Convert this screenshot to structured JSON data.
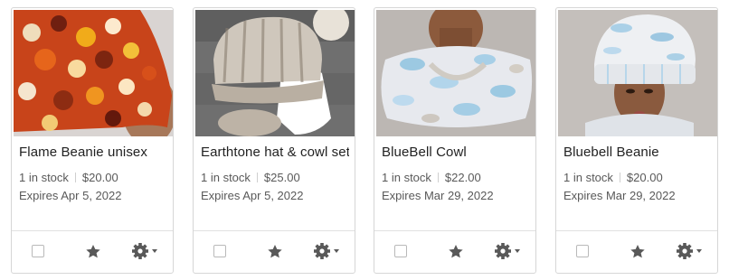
{
  "listings": [
    {
      "title": "Flame Beanie unisex",
      "stock": "1 in stock",
      "price": "$20.00",
      "expires": "Expires Apr 5, 2022",
      "image": "flame-beanie-photo"
    },
    {
      "title": "Earthtone hat & cowl set",
      "stock": "1 in stock",
      "price": "$25.00",
      "expires": "Expires Apr 5, 2022",
      "image": "earthtone-hat-photo"
    },
    {
      "title": "BlueBell Cowl",
      "stock": "1 in stock",
      "price": "$22.00",
      "expires": "Expires Mar 29, 2022",
      "image": "bluebell-cowl-photo"
    },
    {
      "title": "Bluebell Beanie",
      "stock": "1 in stock",
      "price": "$20.00",
      "expires": "Expires Mar 29, 2022",
      "image": "bluebell-beanie-photo"
    }
  ],
  "icons": {
    "select": "checkbox-icon",
    "feature": "star-icon",
    "options": "gear-icon"
  },
  "colors": {
    "icon": "#595959",
    "border": "#d6d6d6"
  }
}
